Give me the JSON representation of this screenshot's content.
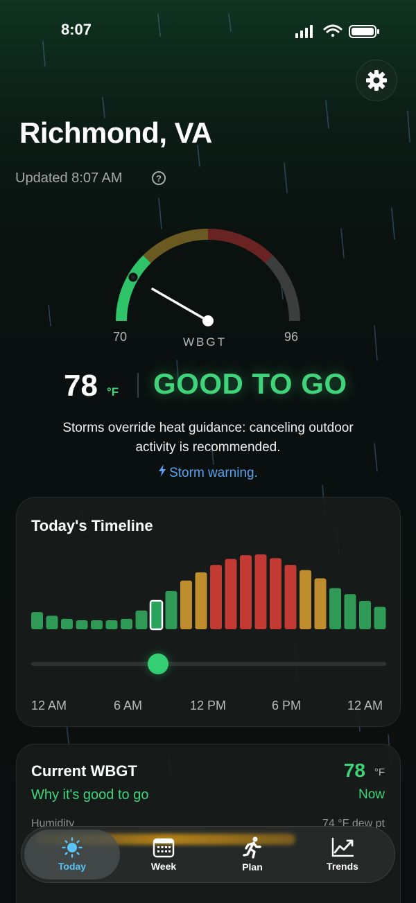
{
  "status_bar": {
    "time": "8:07"
  },
  "header": {
    "city": "Richmond, VA",
    "updated": "Updated 8:07 AM",
    "help_glyph": "?"
  },
  "gauge": {
    "min": "70",
    "max": "96",
    "label": "WBGT",
    "value": 78,
    "range": [
      70,
      96
    ]
  },
  "reading": {
    "temp": "78",
    "unit": "°F",
    "verdict": "GOOD TO GO",
    "message": "Storms override heat guidance: canceling outdoor activity is recommended.",
    "storm_warning": "Storm warning."
  },
  "timeline": {
    "title": "Today's Timeline",
    "x_labels": [
      "12 AM",
      "6 AM",
      "12 PM",
      "6 PM",
      "12 AM"
    ],
    "hourly_levels": [
      0.23,
      0.18,
      0.14,
      0.12,
      0.12,
      0.12,
      0.14,
      0.25,
      0.38,
      0.51,
      0.65,
      0.76,
      0.86,
      0.94,
      0.99,
      1.0,
      0.95,
      0.86,
      0.79,
      0.68,
      0.55,
      0.47,
      0.38,
      0.3
    ],
    "current_hour_index": 8,
    "colors": {
      "good": "#2e9a55",
      "caution": "#bf8c2e",
      "danger": "#c23a33"
    }
  },
  "current": {
    "title": "Current WBGT",
    "subtitle": "Why it's good to go",
    "value": "78",
    "unit": "°F",
    "when": "Now",
    "row_label": "Humidity",
    "row_value": "74 °F dew pt"
  },
  "tabs": [
    {
      "label": "Today",
      "icon": "sun-icon",
      "active": true
    },
    {
      "label": "Week",
      "icon": "calendar-icon",
      "active": false
    },
    {
      "label": "Plan",
      "icon": "runner-icon",
      "active": false
    },
    {
      "label": "Trends",
      "icon": "chart-line-icon",
      "active": false
    }
  ],
  "colors": {
    "accent": "#3fd47a",
    "storm": "#5aa2f0",
    "tab_active": "#5bc3f5"
  }
}
